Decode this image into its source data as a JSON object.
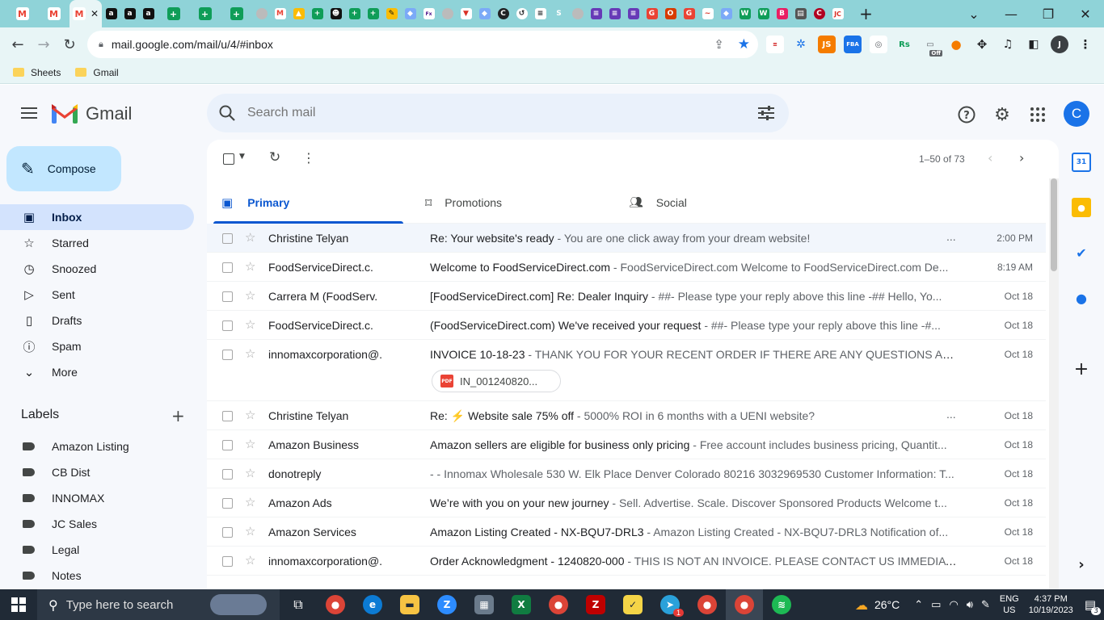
{
  "browser": {
    "tabs": [
      "Gmail",
      "Gmail",
      "Gmail",
      "Amazon",
      "Amazon",
      "Amazon",
      "Sheets",
      "Sheets",
      "Sheets",
      "Tab",
      "Gmail",
      "Drive",
      "Sheets",
      "Tab",
      "Sheets",
      "Sheets",
      "Tab",
      "Tab",
      "Tab",
      "Tab",
      "Tab",
      "Tab",
      "Tab",
      "Tab",
      "Tab",
      "Tab",
      "Tab",
      "Tab",
      "Tab",
      "Tab",
      "Tab",
      "Tab",
      "Tab",
      "Tab",
      "Tab",
      "Tab",
      "Tab",
      "Tab",
      "Tab",
      "Tab",
      "Tab",
      "Tab"
    ],
    "url": "mail.google.com/mail/u/4/#inbox",
    "bookmarks": [
      "Sheets",
      "Gmail"
    ],
    "profile_initial": "J",
    "ext_off_badge": "Off"
  },
  "gmail": {
    "logo_text": "Gmail",
    "search_placeholder": "Search mail",
    "avatar_initial": "C",
    "compose_label": "Compose",
    "nav": [
      {
        "label": "Inbox",
        "icon": "inbox-icon"
      },
      {
        "label": "Starred",
        "icon": "star-icon"
      },
      {
        "label": "Snoozed",
        "icon": "clock-icon"
      },
      {
        "label": "Sent",
        "icon": "send-icon"
      },
      {
        "label": "Drafts",
        "icon": "draft-icon"
      },
      {
        "label": "Spam",
        "icon": "spam-icon"
      },
      {
        "label": "More",
        "icon": "chevron-down-icon"
      }
    ],
    "labels_heading": "Labels",
    "labels": [
      "Amazon Listing",
      "CB Dist",
      "INNOMAX",
      "JC Sales",
      "Legal",
      "Notes"
    ],
    "pagination": "1–50 of 73",
    "tabs": [
      "Primary",
      "Promotions",
      "Social"
    ],
    "emails": [
      {
        "sender": "Christine Telyan",
        "subject": "Re: Your website's ready",
        "snippet": " - You are one click away from your dream website!",
        "date": "2:00 PM",
        "dots": "..."
      },
      {
        "sender": "FoodServiceDirect.c.",
        "subject": "Welcome to FoodServiceDirect.com",
        "snippet": " - FoodServiceDirect.com Welcome to FoodServiceDirect.com De...",
        "date": "8:19 AM",
        "dots": ""
      },
      {
        "sender": "Carrera M (FoodServ.",
        "subject": "[FoodServiceDirect.com] Re: Dealer Inquiry",
        "snippet": " - ##- Please type your reply above this line -## Hello, Yo...",
        "date": "Oct 18",
        "dots": ""
      },
      {
        "sender": "FoodServiceDirect.c.",
        "subject": "(FoodServiceDirect.com) We've received your request",
        "snippet": " - ##- Please type your reply above this line -#...",
        "date": "Oct 18",
        "dots": ""
      },
      {
        "sender": "innomaxcorporation@.",
        "subject": "INVOICE 10-18-23",
        "snippet": " - THANK YOU FOR YOUR RECENT ORDER IF THERE ARE ANY QUESTIONS ABOUT Y...",
        "date": "Oct 18",
        "dots": "",
        "attachment": "IN_001240820..."
      },
      {
        "sender": "Christine Telyan",
        "subject": "Re: ⚡ Website sale 75% off",
        "snippet": " - 5000% ROI in 6 months with a UENI website?",
        "date": "Oct 18",
        "dots": "..."
      },
      {
        "sender": "Amazon Business",
        "subject": "Amazon sellers are eligible for business only pricing",
        "snippet": " - Free account includes business pricing, Quantit...",
        "date": "Oct 18",
        "dots": ""
      },
      {
        "sender": "donotreply",
        "subject": "",
        "snippet": "- - Innomax Wholesale 530 W. Elk Place Denver Colorado 80216 3032969530 Customer Information: T...",
        "date": "Oct 18",
        "dots": ""
      },
      {
        "sender": "Amazon Ads",
        "subject": "We’re with you on your new journey",
        "snippet": " - Sell. Advertise. Scale. Discover Sponsored Products Welcome t...",
        "date": "Oct 18",
        "dots": ""
      },
      {
        "sender": "Amazon Services",
        "subject": "Amazon Listing Created - NX-BQU7-DRL3",
        "snippet": " - Amazon Listing Created - NX-BQU7-DRL3 Notification of...",
        "date": "Oct 18",
        "dots": ""
      },
      {
        "sender": "innomaxcorporation@.",
        "subject": "Order Acknowledgment - 1240820-000",
        "snippet": " - THIS IS NOT AN INVOICE. PLEASE CONTACT US IMMEDIAT...",
        "date": "Oct 18",
        "dots": ""
      }
    ]
  },
  "taskbar": {
    "search_placeholder": "Type here to search",
    "weather": "26°C",
    "lang_top": "ENG",
    "lang_bottom": "US",
    "time": "4:37 PM",
    "date": "10/19/2023",
    "notification_count": "3",
    "telegram_badge": "1"
  }
}
